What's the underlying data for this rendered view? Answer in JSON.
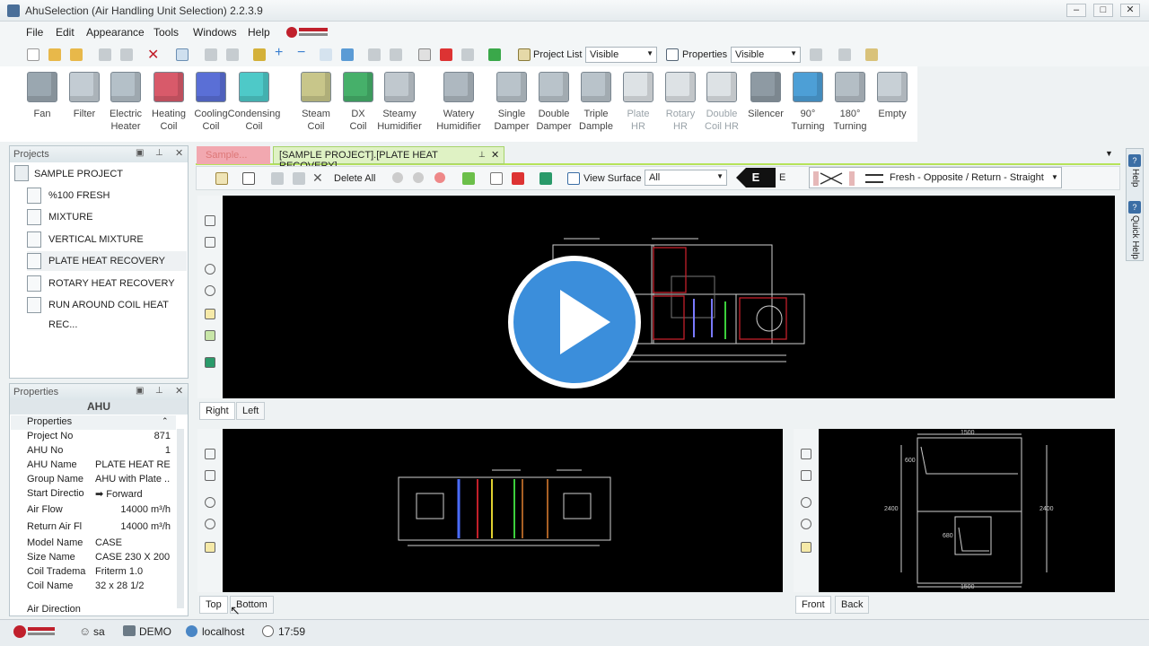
{
  "window": {
    "title": "AhuSelection (Air Handling Unit Selection) 2.2.3.9"
  },
  "menu": [
    "File",
    "Edit",
    "Appearance",
    "Tools",
    "Windows",
    "Help"
  ],
  "toolbar": {
    "project_list_label": "Project List",
    "project_list_value": "Visible",
    "properties_label": "Properties",
    "properties_value": "Visible"
  },
  "ribbon": [
    {
      "l1": "Fan",
      "l2": "",
      "color": "#9aa7b0"
    },
    {
      "l1": "Filter",
      "l2": "",
      "color": "#c3ccd3"
    },
    {
      "l1": "Electric",
      "l2": "Heater",
      "color": "#b4c0c8"
    },
    {
      "l1": "Heating",
      "l2": "Coil",
      "color": "#d85a6a"
    },
    {
      "l1": "Cooling",
      "l2": "Coil",
      "color": "#5a6fd6"
    },
    {
      "l1": "Condensing",
      "l2": "Coil",
      "color": "#4ec9c8"
    },
    {
      "l1": "Steam",
      "l2": "Coil",
      "color": "#c8c68a"
    },
    {
      "l1": "DX",
      "l2": "Coil",
      "color": "#46b06a"
    },
    {
      "l1": "Steamy",
      "l2": "Humidifier",
      "color": "#c0c8ce"
    },
    {
      "l1": "Watery",
      "l2": "Humidifier",
      "color": "#aeb8c0"
    },
    {
      "l1": "Single",
      "l2": "Damper",
      "color": "#b9c3ca"
    },
    {
      "l1": "Double",
      "l2": "Damper",
      "color": "#b9c3ca"
    },
    {
      "l1": "Triple",
      "l2": "Dample",
      "color": "#b9c3ca"
    },
    {
      "l1": "Plate",
      "l2": "HR",
      "color": "#dde2e5",
      "disabled": true
    },
    {
      "l1": "Rotary",
      "l2": "HR",
      "color": "#dde2e5",
      "disabled": true
    },
    {
      "l1": "Double",
      "l2": "Coil HR",
      "color": "#dde2e5",
      "disabled": true
    },
    {
      "l1": "Silencer",
      "l2": "",
      "color": "#8e9aa3"
    },
    {
      "l1": "90°",
      "l2": "Turning",
      "color": "#4d9fd6"
    },
    {
      "l1": "180°",
      "l2": "Turning",
      "color": "#b4bec5"
    },
    {
      "l1": "Empty",
      "l2": "",
      "color": "#c8d0d6"
    }
  ],
  "projects": {
    "header": "Projects",
    "root": "SAMPLE PROJECT",
    "items": [
      "%100 FRESH",
      "MIXTURE",
      "VERTICAL MIXTURE",
      "PLATE HEAT RECOVERY",
      "ROTARY HEAT RECOVERY",
      "RUN AROUND COIL HEAT REC..."
    ]
  },
  "properties": {
    "header": "Properties",
    "title": "AHU",
    "section": "Properties",
    "rows": [
      {
        "k": "Project No",
        "v": "871",
        "r": true
      },
      {
        "k": "AHU No",
        "v": "1",
        "r": true
      },
      {
        "k": "AHU Name",
        "v": "PLATE HEAT RE..."
      },
      {
        "k": "Group Name",
        "v": "AHU with Plate ..."
      },
      {
        "k": "Start Directio",
        "v": "➡ Forward"
      },
      {
        "k": "Air Flow",
        "v": "14000  m³/h",
        "r": true
      },
      {
        "k": "Return Air Fl",
        "v": "14000  m³/h",
        "r": true
      },
      {
        "k": "Model Name",
        "v": "CASE"
      },
      {
        "k": "Size Name",
        "v": "CASE 230 X 200"
      },
      {
        "k": "Coil Tradema",
        "v": "Friterm 1.0"
      },
      {
        "k": "Coil Name",
        "v": "32 x 28 1/2"
      },
      {
        "k": "Air Direction",
        "v": ""
      }
    ]
  },
  "doc": {
    "tab_inactive": "Sample...",
    "tab_active": "[SAMPLE PROJECT].[PLATE HEAT RECOVERY]",
    "delete_all": "Delete All",
    "view_surface_label": "View Surface",
    "view_surface_value": "All",
    "e_label": "E",
    "flow_value": "Fresh - Opposite / Return - Straight"
  },
  "views": {
    "right": "Right",
    "left": "Left",
    "top": "Top",
    "bottom": "Bottom",
    "front": "Front",
    "back": "Back"
  },
  "dims": {
    "top1": "1500",
    "left1": "600",
    "left2": "680",
    "h1": "2400",
    "h2": "2400",
    "bottom1": "1500"
  },
  "side_tabs": [
    "Help",
    "Quick Help"
  ],
  "status": {
    "user": "sa",
    "db": "DEMO",
    "server": "localhost",
    "time": "17:59"
  }
}
